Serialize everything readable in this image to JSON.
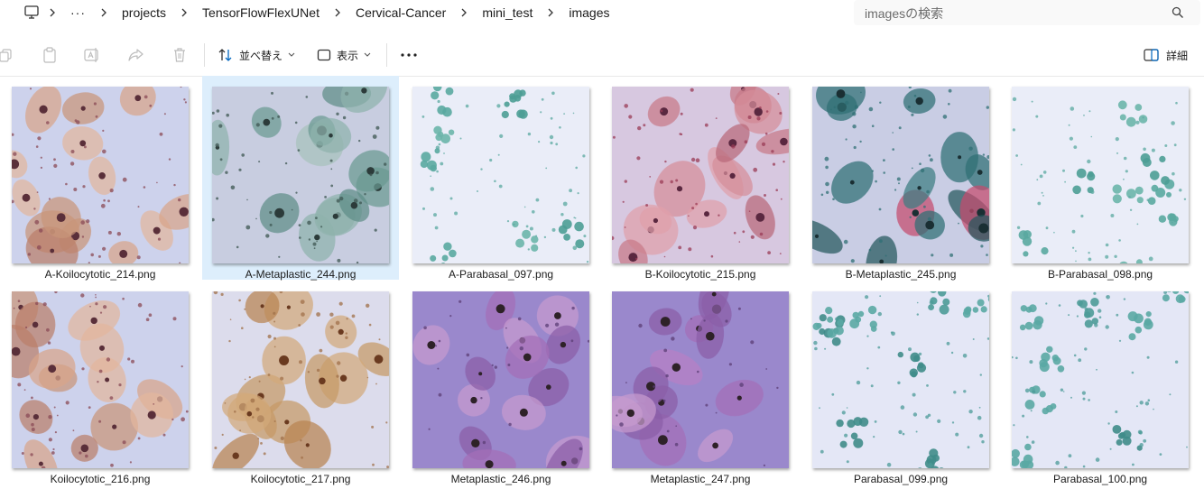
{
  "address_bar": {
    "overflow": "···",
    "breadcrumbs": [
      "projects",
      "TensorFlowFlexUNet",
      "Cervical-Cancer",
      "mini_test",
      "images"
    ],
    "search_placeholder": "imagesの検索"
  },
  "toolbar": {
    "sort_label": "並べ替え",
    "view_label": "表示",
    "details_label": "詳細"
  },
  "files": [
    {
      "name": "A-Koilocytotic_214.png",
      "selected": false,
      "style": "pink"
    },
    {
      "name": "A-Metaplastic_244.png",
      "selected": true,
      "style": "teal"
    },
    {
      "name": "A-Parabasal_097.png",
      "selected": false,
      "style": "sparse"
    },
    {
      "name": "B-Koilocytotic_215.png",
      "selected": false,
      "style": "rose"
    },
    {
      "name": "B-Metaplastic_245.png",
      "selected": false,
      "style": "dark"
    },
    {
      "name": "B-Parabasal_098.png",
      "selected": false,
      "style": "sparse"
    },
    {
      "name": "Koilocytotic_216.png",
      "selected": false,
      "style": "pink"
    },
    {
      "name": "Koilocytotic_217.png",
      "selected": false,
      "style": "brown"
    },
    {
      "name": "Metaplastic_246.png",
      "selected": false,
      "style": "purple"
    },
    {
      "name": "Metaplastic_247.png",
      "selected": false,
      "style": "purple"
    },
    {
      "name": "Parabasal_099.png",
      "selected": false,
      "style": "cluster"
    },
    {
      "name": "Parabasal_100.png",
      "selected": false,
      "style": "cluster"
    }
  ],
  "colors": {
    "selection": "#ddeefc",
    "accent": "#0067c0"
  }
}
